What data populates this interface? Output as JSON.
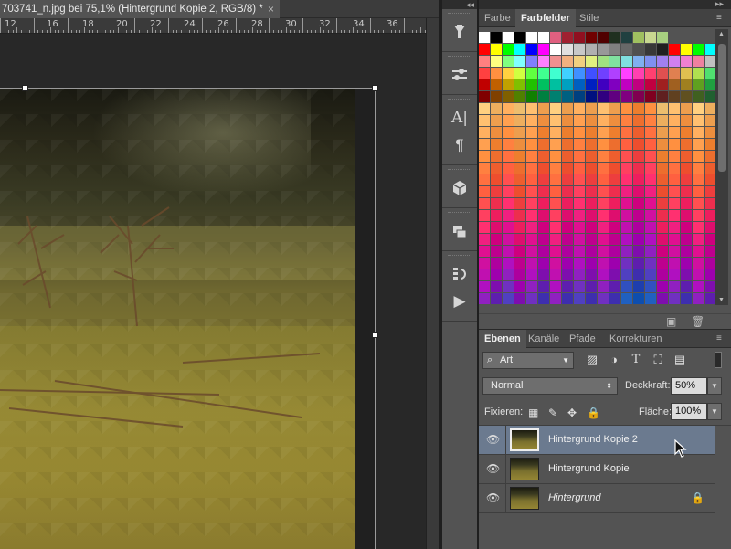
{
  "document": {
    "tab_title": "703741_n.jpg bei 75,1% (Hintergrund Kopie 2, RGB/8) *",
    "close_glyph": "×"
  },
  "ruler": {
    "labels": [
      "12",
      "16",
      "18",
      "20",
      "22",
      "24",
      "26",
      "28",
      "30",
      "32",
      "34",
      "36"
    ]
  },
  "toolstrip": {
    "header_glyph": "◂◂"
  },
  "panel_top": {
    "collapse_glyph": "▸▸"
  },
  "swatch_tabs": {
    "tabs": [
      "Farbe",
      "Farbfelder",
      "Stile"
    ],
    "active": "Farbfelder"
  },
  "layers_tabs": {
    "tabs": [
      "Ebenen",
      "Kanäle",
      "Pfade",
      "Korrekturen"
    ],
    "active": "Ebenen"
  },
  "layers": {
    "filter_label": "Art",
    "blend_mode": "Normal",
    "opacity_label": "Deckkraft:",
    "opacity_value": "50%",
    "lock_label": "Fixieren:",
    "fill_label": "Fläche:",
    "fill_value": "100%",
    "items": [
      {
        "name": "Hintergrund Kopie 2",
        "selected": true,
        "locked": false,
        "italic": false
      },
      {
        "name": "Hintergrund Kopie",
        "selected": false,
        "locked": false,
        "italic": false
      },
      {
        "name": "Hintergrund",
        "selected": false,
        "locked": true,
        "italic": true
      }
    ]
  },
  "colors": {
    "accent_selected_layer": "#6b7a8f",
    "panel_bg": "#535353",
    "workspace_bg": "#282828"
  }
}
